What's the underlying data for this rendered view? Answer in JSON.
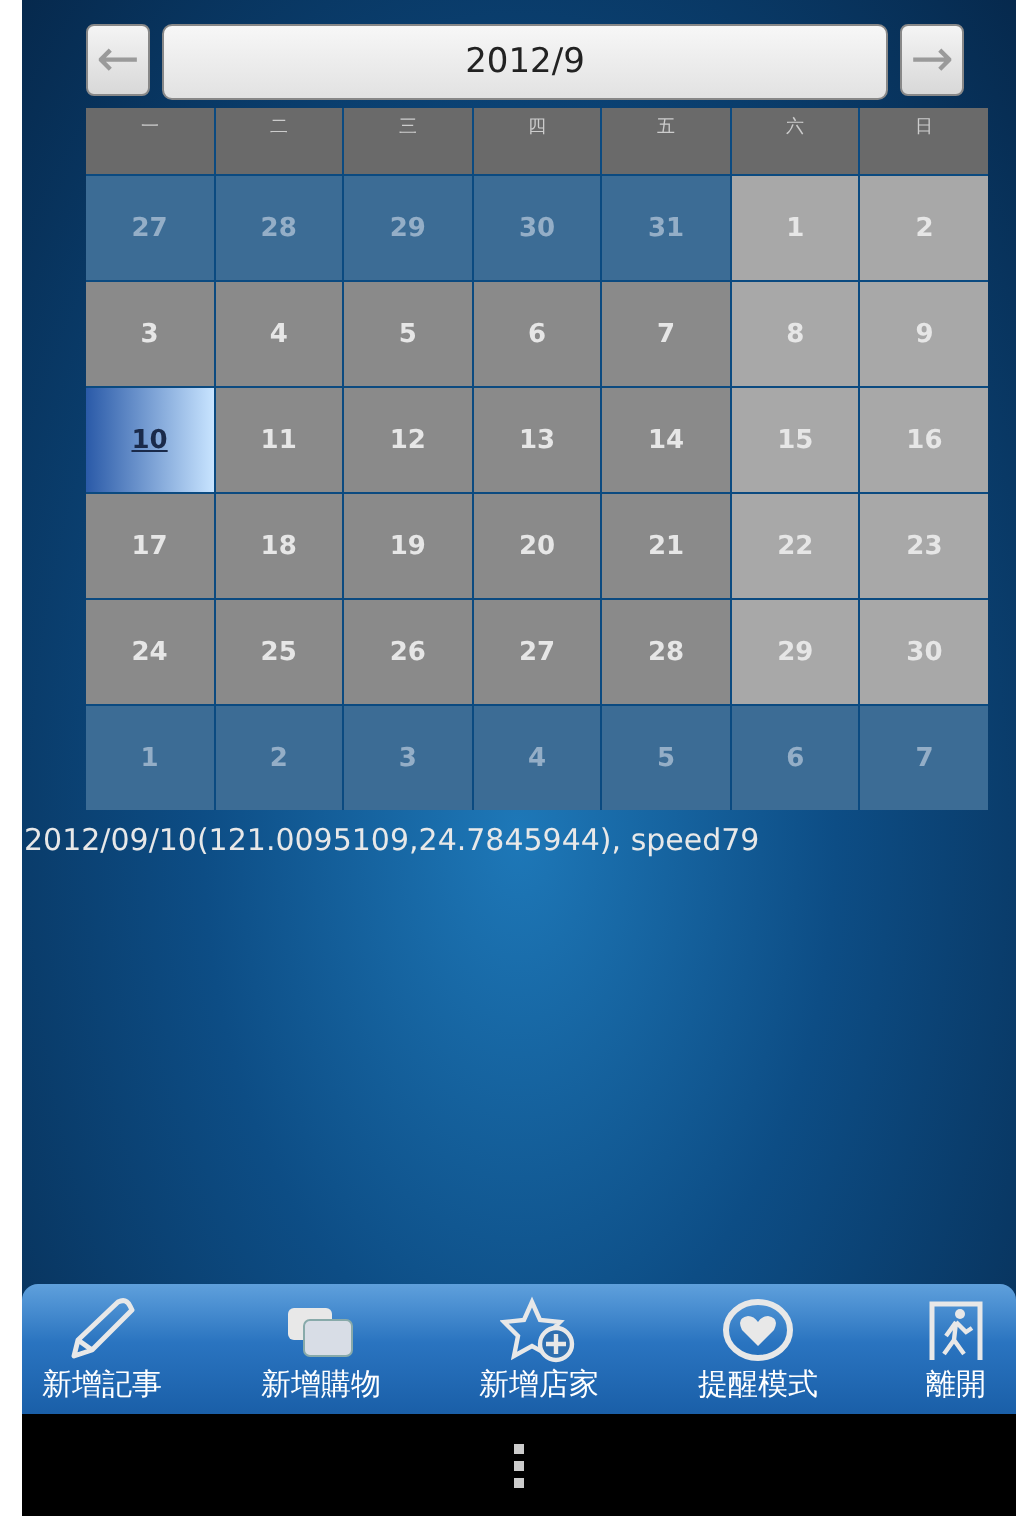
{
  "header": {
    "prev_label": "←",
    "title": "2012/9",
    "next_label": "→"
  },
  "weekdays": [
    "一",
    "二",
    "三",
    "四",
    "五",
    "六",
    "日"
  ],
  "weeks": [
    [
      {
        "day": "27",
        "kind": "outside",
        "selected": false
      },
      {
        "day": "28",
        "kind": "outside",
        "selected": false
      },
      {
        "day": "29",
        "kind": "outside",
        "selected": false
      },
      {
        "day": "30",
        "kind": "outside",
        "selected": false
      },
      {
        "day": "31",
        "kind": "outside",
        "selected": false
      },
      {
        "day": "1",
        "kind": "weekend",
        "selected": false
      },
      {
        "day": "2",
        "kind": "weekend",
        "selected": false
      }
    ],
    [
      {
        "day": "3",
        "kind": "weekday",
        "selected": false
      },
      {
        "day": "4",
        "kind": "weekday",
        "selected": false
      },
      {
        "day": "5",
        "kind": "weekday",
        "selected": false
      },
      {
        "day": "6",
        "kind": "weekday",
        "selected": false
      },
      {
        "day": "7",
        "kind": "weekday",
        "selected": false
      },
      {
        "day": "8",
        "kind": "weekend",
        "selected": false
      },
      {
        "day": "9",
        "kind": "weekend",
        "selected": false
      }
    ],
    [
      {
        "day": "10",
        "kind": "weekday",
        "selected": true
      },
      {
        "day": "11",
        "kind": "weekday",
        "selected": false
      },
      {
        "day": "12",
        "kind": "weekday",
        "selected": false
      },
      {
        "day": "13",
        "kind": "weekday",
        "selected": false
      },
      {
        "day": "14",
        "kind": "weekday",
        "selected": false
      },
      {
        "day": "15",
        "kind": "weekend",
        "selected": false
      },
      {
        "day": "16",
        "kind": "weekend",
        "selected": false
      }
    ],
    [
      {
        "day": "17",
        "kind": "weekday",
        "selected": false
      },
      {
        "day": "18",
        "kind": "weekday",
        "selected": false
      },
      {
        "day": "19",
        "kind": "weekday",
        "selected": false
      },
      {
        "day": "20",
        "kind": "weekday",
        "selected": false
      },
      {
        "day": "21",
        "kind": "weekday",
        "selected": false
      },
      {
        "day": "22",
        "kind": "weekend",
        "selected": false
      },
      {
        "day": "23",
        "kind": "weekend",
        "selected": false
      }
    ],
    [
      {
        "day": "24",
        "kind": "weekday",
        "selected": false
      },
      {
        "day": "25",
        "kind": "weekday",
        "selected": false
      },
      {
        "day": "26",
        "kind": "weekday",
        "selected": false
      },
      {
        "day": "27",
        "kind": "weekday",
        "selected": false
      },
      {
        "day": "28",
        "kind": "weekday",
        "selected": false
      },
      {
        "day": "29",
        "kind": "weekend",
        "selected": false
      },
      {
        "day": "30",
        "kind": "weekend",
        "selected": false
      }
    ],
    [
      {
        "day": "1",
        "kind": "outside",
        "selected": false
      },
      {
        "day": "2",
        "kind": "outside",
        "selected": false
      },
      {
        "day": "3",
        "kind": "outside",
        "selected": false
      },
      {
        "day": "4",
        "kind": "outside",
        "selected": false
      },
      {
        "day": "5",
        "kind": "outside",
        "selected": false
      },
      {
        "day": "6",
        "kind": "outside",
        "selected": false
      },
      {
        "day": "7",
        "kind": "outside",
        "selected": false
      }
    ]
  ],
  "status_text": "2012/09/10(121.0095109,24.7845944), speed79",
  "toolbar": [
    {
      "label": "新增記事",
      "kind": "pencil"
    },
    {
      "label": "新增購物",
      "kind": "cards"
    },
    {
      "label": "新增店家",
      "kind": "star"
    },
    {
      "label": "提醒模式",
      "kind": "heart"
    },
    {
      "label": "離開",
      "kind": "exit"
    }
  ]
}
